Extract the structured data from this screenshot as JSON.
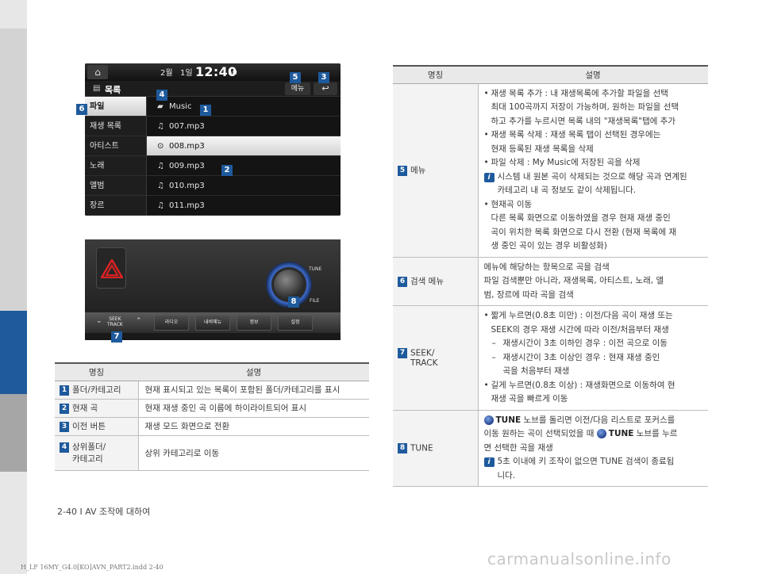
{
  "screen_list": {
    "status": {
      "left": "2월",
      "mid": "1일",
      "clock": "12:40",
      "ampm": "AM"
    },
    "title": "목록",
    "menu_btn": "메뉴",
    "back_icon": "back-arrow-icon",
    "categories": [
      "파일",
      "재생 목록",
      "아티스트",
      "노래",
      "앨범",
      "장르"
    ],
    "folder": "Music",
    "files": [
      "007.mp3",
      "008.mp3",
      "009.mp3",
      "010.mp3",
      "011.mp3"
    ]
  },
  "panel": {
    "tune_label": "TUNE",
    "file_label": "FILE",
    "seek_label_1": "SEEK",
    "seek_label_2": "TRACK",
    "buttons": [
      "라디오",
      "내비메뉴",
      "정보",
      "설정"
    ]
  },
  "markers": [
    "1",
    "2",
    "3",
    "4",
    "5",
    "6",
    "7",
    "8"
  ],
  "table1": {
    "head_name": "명칭",
    "head_desc": "설명",
    "rows": [
      {
        "num": "1",
        "name": "폴더/카테고리",
        "desc": "현재 표시되고 있는 목록이 포함된 폴더/카테고리를 표시"
      },
      {
        "num": "2",
        "name": "현재 곡",
        "desc": "현재 재생 중인 곡 이름에 하이라이트되어 표시"
      },
      {
        "num": "3",
        "name": "이전 버튼",
        "desc": "재생 모드 화면으로 전환"
      },
      {
        "num": "4",
        "name_1": "상위폴더/",
        "name_2": "카테고리",
        "desc": "상위 카테고리로 이동"
      }
    ]
  },
  "table2": {
    "head_name": "명칭",
    "head_desc": "설명",
    "r5": {
      "num": "5",
      "name": "메뉴",
      "b1": "재생 목록 추가 : 내 재생목록에 추가할 파일을 선택",
      "b1_2": "최대 100곡까지 저장이 가능하며, 원하는 파일을 선택",
      "b1_3": "하고 추가를 누르시면 목록 내의 \"재생목록\"탭에 추가",
      "b2": "재생 목록 삭제 : 재생 목록 탭이 선택된 경우에는",
      "b2_2": "현재 등록된 재생 목록을 삭제",
      "b3": "파일 삭제 : My Music에 저장된 곡을 삭제",
      "i1": "시스템 내 원본 곡이 삭제되는 것으로 해당 곡과 연계된",
      "i1_2": "카테고리 내 곡 정보도 같이 삭제됩니다.",
      "b4": "현재곡 이동",
      "b4_2": "다른 목록 화면으로 이동하였을 경우 현재 재생 중인",
      "b4_3": "곡이 위치한 목록 화면으로 다시 전환 (현재 목록에 재",
      "b4_4": "생 중인 곡이 있는 경우 비활성화)"
    },
    "r6": {
      "num": "6",
      "name": "검색 메뉴",
      "l1": "메뉴에 해당하는 항목으로 곡을 검색",
      "l2": "파일 검색뿐만 아니라, 재생목록, 아티스트, 노래, 앨",
      "l3": "범, 장르에 따라 곡을 검색"
    },
    "r7": {
      "num": "7",
      "name_1": "SEEK/",
      "name_2": "TRACK",
      "b1": "짧게 누르면(0.8초 미만) : 이전/다음 곡이 재생 또는",
      "b1_2": "SEEK의 경우 재생 시간에 따라 이전/처음부터 재생",
      "d1": "재생시간이 3초 이하인 경우 : 이전 곡으로 이동",
      "d2": "재생시간이 3초 이상인 경우 : 현재 재생 중인",
      "d2_2": "곡을 처음부터 재생",
      "b2": "길게 누르면(0.8초 이상) : 재생화면으로 이동하여 현",
      "b2_2": "재생 곡을 빠르게 이동"
    },
    "r8": {
      "num": "8",
      "name": "TUNE",
      "tune_word": "TUNE",
      "l1_rest": " 노브를 돌리면 이전/다음 리스트로 포커스를",
      "l2_a": "이동 원하는 곡이 선택되었을 때 ",
      "l2_rest": " 노브를 누르",
      "l3": "면 선택한 곡을 재생",
      "i1": "5초 이내에 키 조작이 없으면 TUNE 검색이 종료됩",
      "i1_2": "니다."
    }
  },
  "footer": "2-40 I AV 조작에 대하여",
  "bottom_line": "H_LF 16MY_G4.0[KO]AVN_PART2.indd   2-40",
  "watermark": "carmanualsonline.info",
  "colors": {
    "accent": "#1e5a9c",
    "sidebar_light": "#d3d3d3",
    "sidebar_gray": "#a6a6a6"
  }
}
